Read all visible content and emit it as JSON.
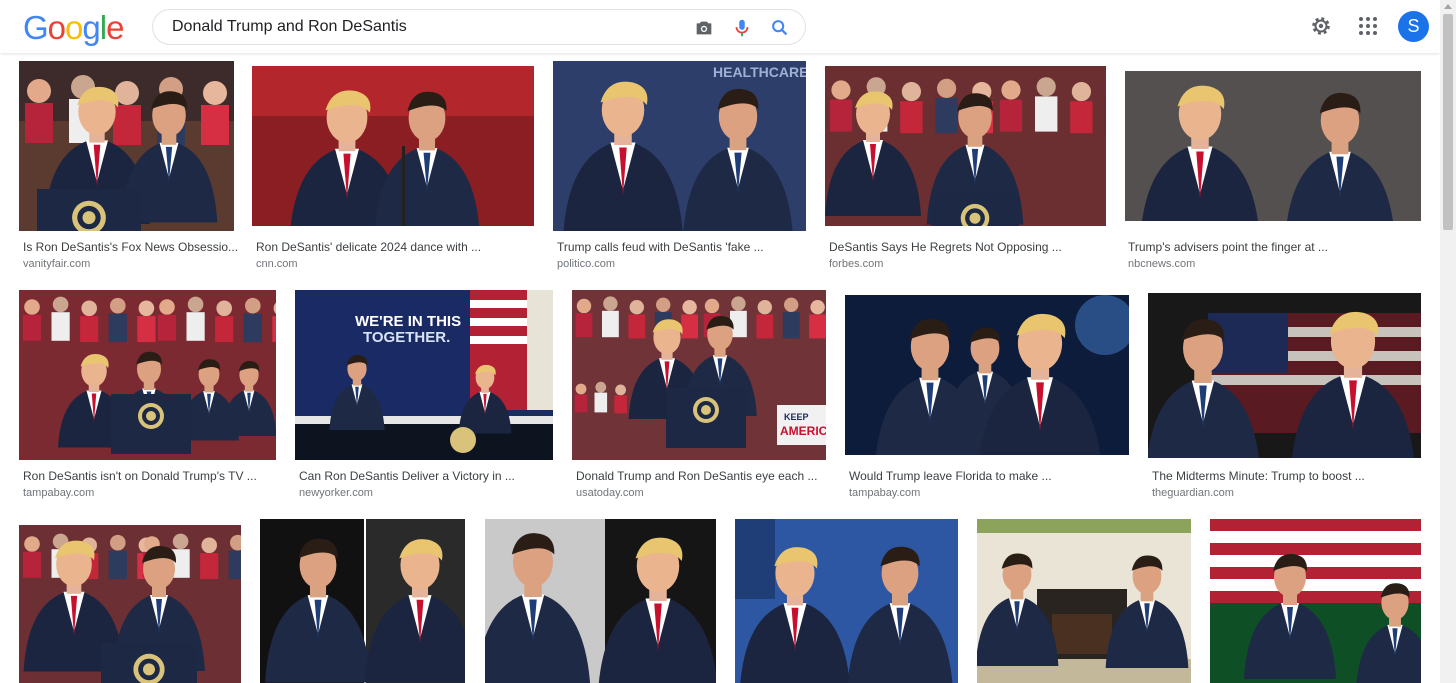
{
  "header": {
    "logo": [
      "G",
      "o",
      "o",
      "g",
      "l",
      "e"
    ],
    "search_query": "Donald Trump and Ron DeSantis",
    "avatar_letter": "S",
    "colors": {
      "blue": "#4285f4",
      "red": "#ea4335",
      "yellow": "#fbbc05",
      "green": "#34a853",
      "avatar": "#1a73e8"
    }
  },
  "results": [
    {
      "title": "Is Ron DeSantis's Fox News Obsessio...",
      "source": "vanityfair.com"
    },
    {
      "title": "Ron DeSantis' delicate 2024 dance with ...",
      "source": "cnn.com"
    },
    {
      "title": "Trump calls feud with DeSantis 'fake ...",
      "source": "politico.com"
    },
    {
      "title": "DeSantis Says He Regrets Not Opposing ...",
      "source": "forbes.com"
    },
    {
      "title": "Trump's advisers point the finger at ...",
      "source": "nbcnews.com"
    },
    {
      "title": "Ron DeSantis isn't on Donald Trump's TV ...",
      "source": "tampabay.com"
    },
    {
      "title": "Can Ron DeSantis Deliver a Victory in ...",
      "source": "newyorker.com"
    },
    {
      "title": "Donald Trump and Ron DeSantis eye each ...",
      "source": "usatoday.com"
    },
    {
      "title": "Would Trump leave Florida to make ...",
      "source": "tampabay.com"
    },
    {
      "title": "The Midterms Minute: Trump to boost ...",
      "source": "theguardian.com"
    },
    {
      "title": "",
      "source": ""
    },
    {
      "title": "",
      "source": ""
    },
    {
      "title": "",
      "source": ""
    },
    {
      "title": "",
      "source": ""
    },
    {
      "title": "",
      "source": ""
    },
    {
      "title": "",
      "source": ""
    }
  ],
  "image_texts": {
    "banner_line1": "WE'RE IN THIS",
    "banner_line2": "TOGETHER.",
    "healthcare": "HEALTHCARE",
    "keep": "KEEP",
    "america": "AMERIC"
  }
}
